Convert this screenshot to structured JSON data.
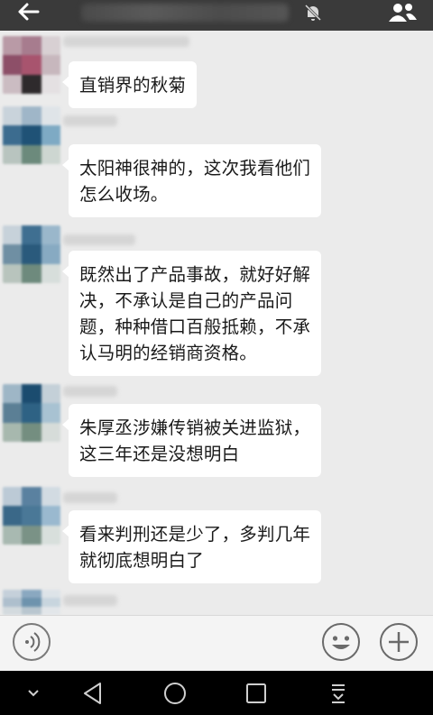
{
  "messages": [
    {
      "text": "直销界的秋菊"
    },
    {
      "text": "太阳神很神的，这次我看他们\n怎么收场。"
    },
    {
      "text": "既然出了产品事故，就好好解\n决，不承认是自己的产品问\n题，种种借口百般抵赖，不承\n认马明的经销商资格。"
    },
    {
      "text": "朱厚丞涉嫌传销被关进监狱，\n这三年还是没想明白"
    },
    {
      "text": "看来判刑还是少了，多判几年\n就彻底想明白了"
    }
  ],
  "icons": {
    "back": "back-arrow-icon",
    "mute": "mute-bell-icon",
    "group": "group-profile-icon",
    "voice": "voice-input-icon",
    "emoji": "emoji-icon",
    "plus": "plus-icon",
    "nav_down": "chevron-down-icon",
    "nav_back": "triangle-back-icon",
    "nav_home": "circle-home-icon",
    "nav_recent": "square-recent-icon",
    "nav_notify": "pull-down-icon"
  },
  "colors": {
    "top_bar": "#3a3a3a",
    "chat_background": "#ebebeb",
    "bubble": "#ffffff",
    "nav_bar": "#000000"
  }
}
